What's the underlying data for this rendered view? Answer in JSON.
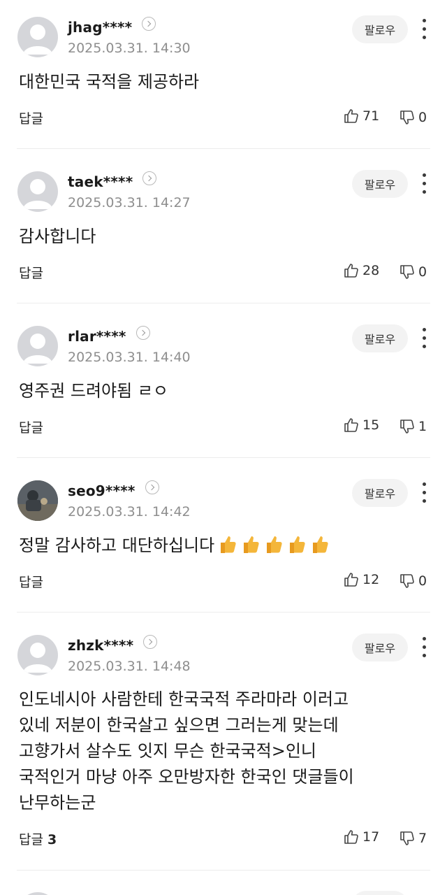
{
  "follow_label": "팔로우",
  "reply_label": "답글",
  "comments": [
    {
      "username": "jhag****",
      "date": "2025.03.31. 14:30",
      "text": "대한민국 국적을 제공하라",
      "reply_count": "",
      "likes": "71",
      "dislikes": "0"
    },
    {
      "username": "taek****",
      "date": "2025.03.31. 14:27",
      "text": "감사합니다",
      "reply_count": "",
      "likes": "28",
      "dislikes": "0"
    },
    {
      "username": "rlar****",
      "date": "2025.03.31. 14:40",
      "text": "영주권 드려야됨 ㄹㅇ",
      "reply_count": "",
      "likes": "15",
      "dislikes": "1"
    },
    {
      "username": "seo9****",
      "date": "2025.03.31. 14:42",
      "text": "정말 감사하고 대단하십니다",
      "reply_count": "",
      "likes": "12",
      "dislikes": "0"
    },
    {
      "username": "zhzk****",
      "date": "2025.03.31. 14:48",
      "text": "인도네시아 사람한테 한국국적 주라마라 이러고\n있네 저분이 한국살고 싶으면 그러는게 맞는데\n고향가서 살수도 잇지 무슨 한국국적>인니\n국적인거 마냥 아주 오만방자한 한국인 댓글들이\n난무하는군",
      "reply_count": "3",
      "likes": "17",
      "dislikes": "7"
    }
  ],
  "icons": {
    "avatar": "default-avatar-icon",
    "verify": "chevron-right-icon",
    "more": "more-vertical-icon",
    "like": "thumbs-up-icon",
    "dislike": "thumbs-down-icon",
    "emoji": "thumbs-up-emoji-icon"
  },
  "colors": {
    "text": "#1a1a1a",
    "muted": "#8e8e8e",
    "follow_bg": "#f3f3f3",
    "avatar_bg": "#d5d6da",
    "emoji": "#f4b63a"
  }
}
